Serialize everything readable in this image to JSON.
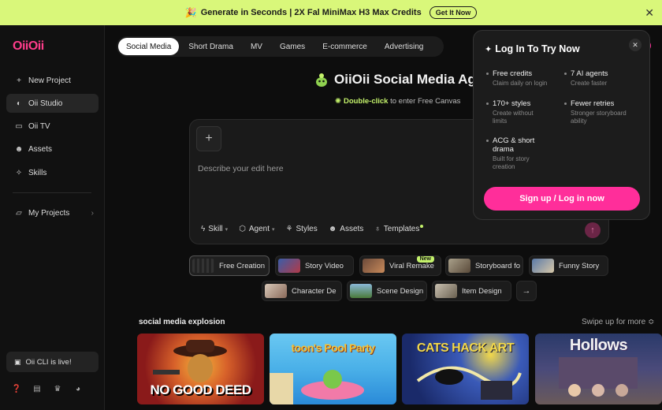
{
  "banner": {
    "emoji": "🎉",
    "text": "Generate in Seconds | 2X Fal MiniMax H3 Max Credits",
    "cta": "Get It Now"
  },
  "logo": "OiiOii",
  "sidebar": {
    "items": [
      {
        "icon": "plus-icon",
        "glyph": "+",
        "label": "New Project"
      },
      {
        "icon": "studio-icon",
        "glyph": "◐",
        "label": "Oii Studio"
      },
      {
        "icon": "tv-icon",
        "glyph": "▭",
        "label": "Oii TV"
      },
      {
        "icon": "assets-icon",
        "glyph": "☻",
        "label": "Assets"
      },
      {
        "icon": "skills-icon",
        "glyph": "✧",
        "label": "Skills"
      }
    ],
    "projects": {
      "icon": "folder-icon",
      "glyph": "▱",
      "label": "My Projects"
    },
    "cli": "Oii CLI is live!"
  },
  "tabs": [
    "Social Media",
    "Short Drama",
    "MV",
    "Games",
    "E-commerce",
    "Advertising"
  ],
  "hero": {
    "title": "OiiOii Social Media Age",
    "sub_highlight": "Double-click",
    "sub_rest": " to enter Free Canvas"
  },
  "editor": {
    "placeholder": "Describe your edit here",
    "tools": [
      "Skill",
      "Agent",
      "Styles",
      "Assets",
      "Templates"
    ]
  },
  "chips": [
    {
      "label": "Free Creation"
    },
    {
      "label": "Story Video"
    },
    {
      "label": "Viral Remake",
      "badge": "New"
    },
    {
      "label": "Storyboard fo"
    },
    {
      "label": "Funny Story"
    },
    {
      "label": "Character De"
    },
    {
      "label": "Scene Design"
    },
    {
      "label": "Item Design"
    }
  ],
  "section": {
    "title": "social media explosion",
    "more": "Swipe up for more"
  },
  "cards": [
    {
      "title": "NO GOOD DEED"
    },
    {
      "title": "toon's Pool Party"
    },
    {
      "title": "CATS HACK ART"
    },
    {
      "title": "Hollows"
    }
  ],
  "popup": {
    "title": "Log In To Try Now",
    "features": [
      {
        "h": "Free credits",
        "d": "Claim daily on login"
      },
      {
        "h": "7 AI agents",
        "d": "Create faster"
      },
      {
        "h": "170+ styles",
        "d": "Create without limits"
      },
      {
        "h": "Fewer retries",
        "d": "Stronger storyboard ability"
      },
      {
        "h": "ACG & short drama",
        "d": "Built for story creation"
      }
    ],
    "button": "Sign up / Log in now"
  },
  "colors": {
    "accent": "#ff2e9a",
    "banner": "#d9f77a",
    "highlight": "#c4f26b"
  }
}
